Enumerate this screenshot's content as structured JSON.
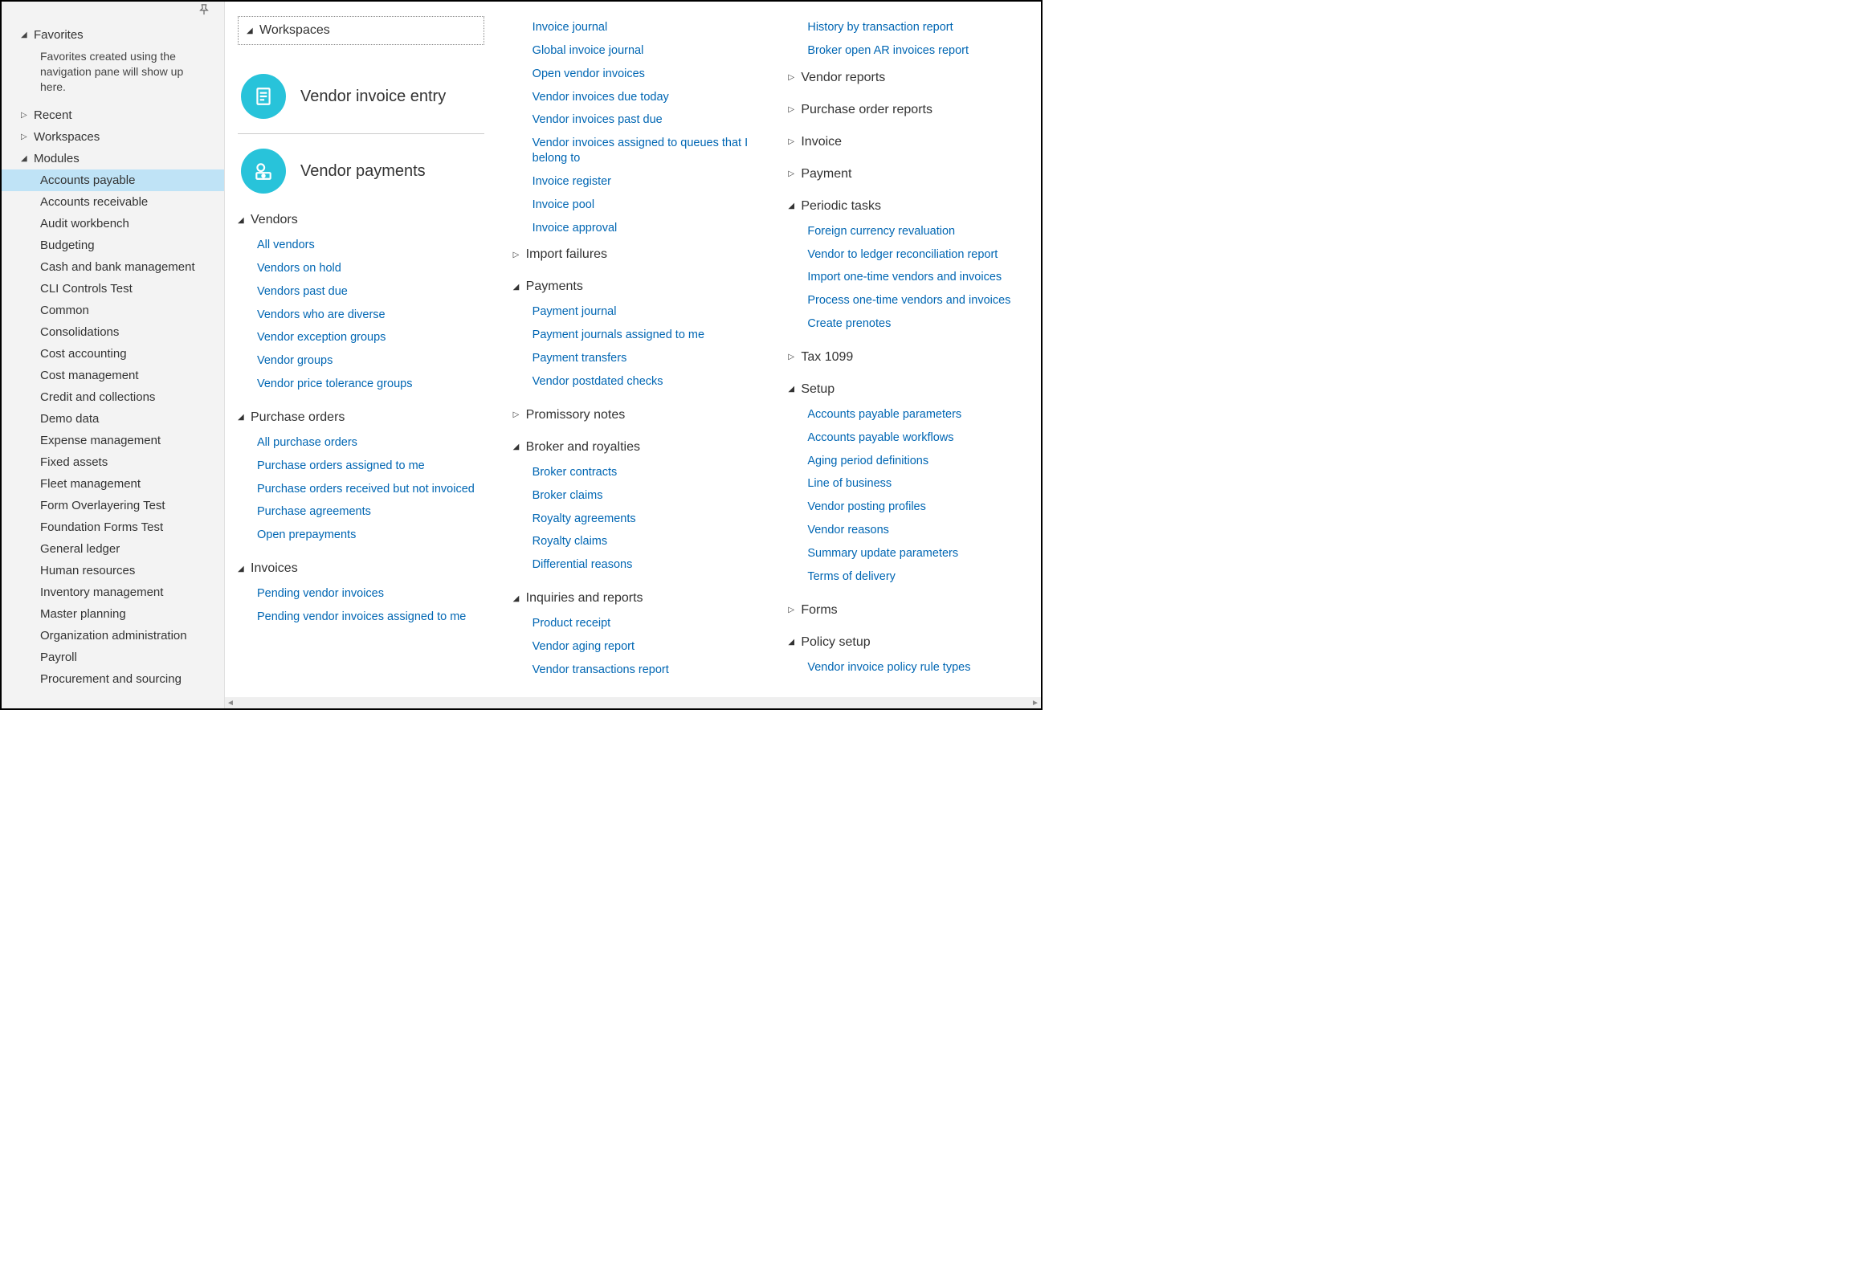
{
  "sidebar": {
    "favorites": {
      "label": "Favorites",
      "hint": "Favorites created using the navigation pane will show up here."
    },
    "recent": {
      "label": "Recent"
    },
    "workspaces": {
      "label": "Workspaces"
    },
    "modules": {
      "label": "Modules",
      "items": [
        "Accounts payable",
        "Accounts receivable",
        "Audit workbench",
        "Budgeting",
        "Cash and bank management",
        "CLI Controls Test",
        "Common",
        "Consolidations",
        "Cost accounting",
        "Cost management",
        "Credit and collections",
        "Demo data",
        "Expense management",
        "Fixed assets",
        "Fleet management",
        "Form Overlayering Test",
        "Foundation Forms Test",
        "General ledger",
        "Human resources",
        "Inventory management",
        "Master planning",
        "Organization administration",
        "Payroll",
        "Procurement and sourcing"
      ],
      "selected_index": 0
    }
  },
  "main": {
    "workspaces": {
      "header": "Workspaces",
      "tiles": [
        {
          "label": "Vendor invoice entry",
          "icon": "invoice-icon"
        },
        {
          "label": "Vendor payments",
          "icon": "payments-icon"
        }
      ]
    },
    "col1_groups": [
      {
        "header": "Vendors",
        "expanded": true,
        "links": [
          "All vendors",
          "Vendors on hold",
          "Vendors past due",
          "Vendors who are diverse",
          "Vendor exception groups",
          "Vendor groups",
          "Vendor price tolerance groups"
        ]
      },
      {
        "header": "Purchase orders",
        "expanded": true,
        "links": [
          "All purchase orders",
          "Purchase orders assigned to me",
          "Purchase orders received but not invoiced",
          "Purchase agreements",
          "Open prepayments"
        ]
      },
      {
        "header": "Invoices",
        "expanded": true,
        "links": [
          "Pending vendor invoices",
          "Pending vendor invoices assigned to me"
        ]
      }
    ],
    "col2_top_links": [
      "Invoice journal",
      "Global invoice journal",
      "Open vendor invoices",
      "Vendor invoices due today",
      "Vendor invoices past due",
      "Vendor invoices assigned to queues that I belong to",
      "Invoice register",
      "Invoice pool",
      "Invoice approval"
    ],
    "col2_groups": [
      {
        "header": "Import failures",
        "expanded": false,
        "links": []
      },
      {
        "header": "Payments",
        "expanded": true,
        "links": [
          "Payment journal",
          "Payment journals assigned to me",
          "Payment transfers",
          "Vendor postdated checks"
        ]
      },
      {
        "header": "Promissory notes",
        "expanded": false,
        "links": []
      },
      {
        "header": "Broker and royalties",
        "expanded": true,
        "links": [
          "Broker contracts",
          "Broker claims",
          "Royalty agreements",
          "Royalty claims",
          "Differential reasons"
        ]
      },
      {
        "header": "Inquiries and reports",
        "expanded": true,
        "links": [
          "Product receipt",
          "Vendor aging report",
          "Vendor transactions report"
        ]
      }
    ],
    "col3_top_links": [
      "History by transaction report",
      "Broker open AR invoices report"
    ],
    "col3_groups": [
      {
        "header": "Vendor reports",
        "expanded": false,
        "links": []
      },
      {
        "header": "Purchase order reports",
        "expanded": false,
        "links": []
      },
      {
        "header": "Invoice",
        "expanded": false,
        "links": []
      },
      {
        "header": "Payment",
        "expanded": false,
        "links": []
      },
      {
        "header": "Periodic tasks",
        "expanded": true,
        "links": [
          "Foreign currency revaluation",
          "Vendor to ledger reconciliation report",
          "Import one-time vendors and invoices",
          "Process one-time vendors and invoices",
          "Create prenotes"
        ]
      },
      {
        "header": "Tax 1099",
        "expanded": false,
        "links": []
      },
      {
        "header": "Setup",
        "expanded": true,
        "links": [
          "Accounts payable parameters",
          "Accounts payable workflows",
          "Aging period definitions",
          "Line of business",
          "Vendor posting profiles",
          "Vendor reasons",
          "Summary update parameters",
          "Terms of delivery"
        ]
      },
      {
        "header": "Forms",
        "expanded": false,
        "links": []
      },
      {
        "header": "Policy setup",
        "expanded": true,
        "links": [
          "Vendor invoice policy rule types"
        ]
      }
    ]
  }
}
